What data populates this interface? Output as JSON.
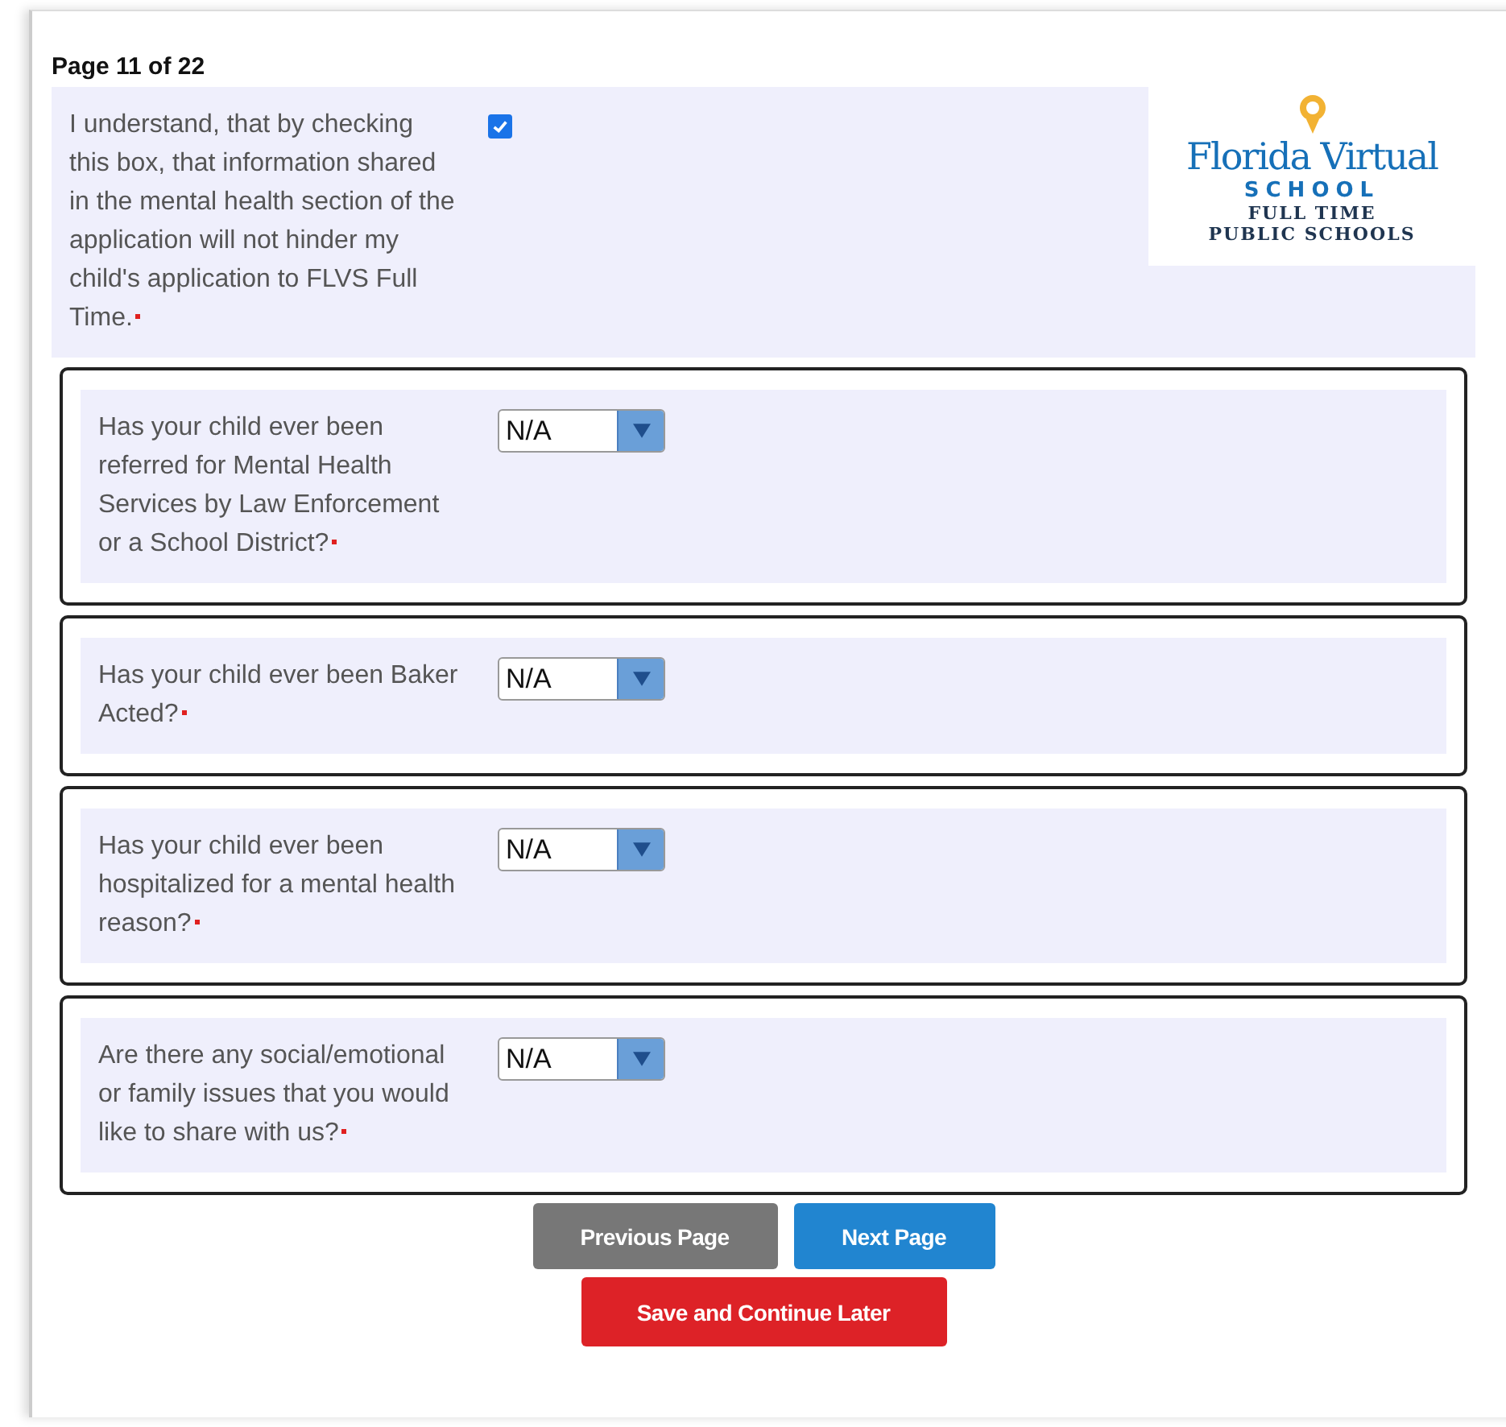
{
  "page_indicator": "Page 11 of 22",
  "consent": {
    "text": "I understand, that by checking this box, that information shared in the mental health section of the application will not hinder my child's application to FLVS Full Time.",
    "checked": true,
    "required": true
  },
  "logo": {
    "name": "Florida Virtual",
    "school": "SCHOOL",
    "line_1": "FULL TIME",
    "line_2": "PUBLIC SCHOOLS"
  },
  "questions": [
    {
      "label": "Has your child ever been referred for Mental Health Services by Law Enforcement or a School District?",
      "value": "N/A",
      "required": true
    },
    {
      "label": "Has your child ever been Baker Acted?",
      "value": "N/A",
      "required": true
    },
    {
      "label": "Has your child ever been hospitalized for a mental health reason?",
      "value": "N/A",
      "required": true
    },
    {
      "label": "Are there any social/emotional or family issues that you would like to share with us?",
      "value": "N/A",
      "required": true
    }
  ],
  "buttons": [
    {
      "label": "Previous Page",
      "kind": "secondary"
    },
    {
      "label": "Next Page",
      "kind": "primary"
    },
    {
      "label": "Save and Continue Later",
      "kind": "danger"
    }
  ]
}
